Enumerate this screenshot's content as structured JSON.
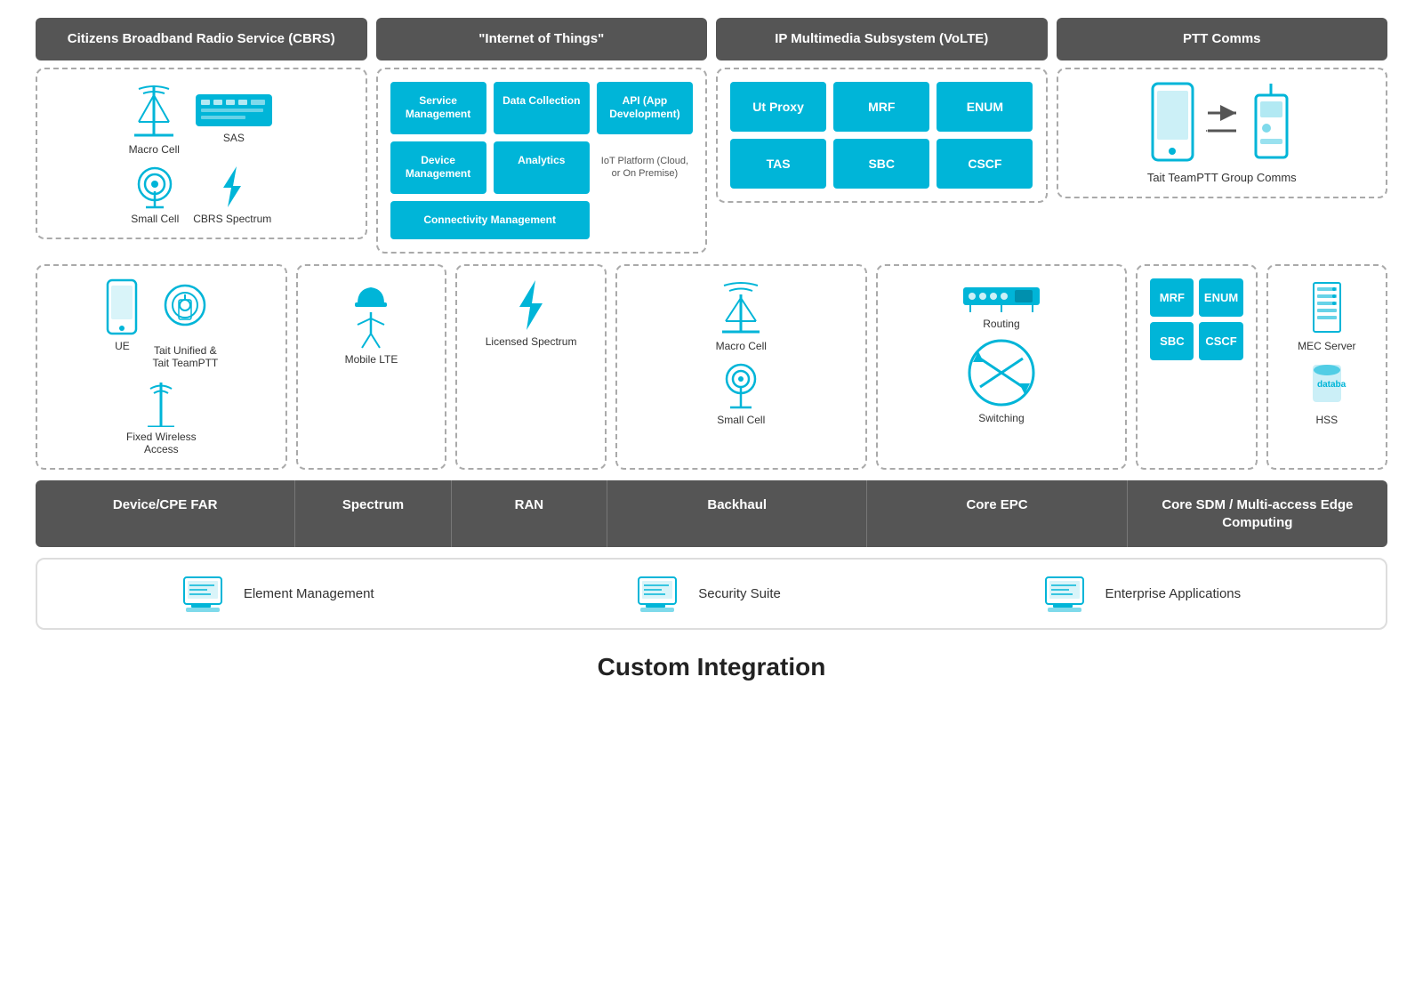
{
  "headers": {
    "cbrs": "Citizens Broadband Radio Service (CBRS)",
    "iot": "\"Internet of Things\"",
    "ims": "IP Multimedia Subsystem (VoLTE)",
    "ptt": "PTT Comms"
  },
  "cbrs": {
    "macro_cell": "Macro Cell",
    "sas": "SAS",
    "small_cell": "Small Cell",
    "cbrs_spectrum": "CBRS Spectrum"
  },
  "iot": {
    "boxes": [
      {
        "label": "Service Management",
        "span": 1
      },
      {
        "label": "Data Collection",
        "span": 1
      },
      {
        "label": "API (App Development)",
        "span": 1
      },
      {
        "label": "Device Management",
        "span": 1
      },
      {
        "label": "Analytics",
        "span": 1
      },
      {
        "label": "",
        "span": 1
      },
      {
        "label": "Connectivity Management",
        "span": 2
      }
    ],
    "platform_note": "IoT Platform (Cloud, or On Premise)"
  },
  "ims": {
    "boxes": [
      "Ut Proxy",
      "MRF",
      "ENUM",
      "TAS",
      "SBC",
      "CSCF"
    ]
  },
  "ptt": {
    "label": "Tait TeamPTT Group Comms"
  },
  "mid": {
    "col1_items": [
      "UE",
      "Tait Unified & Tait TeamPTT",
      "Fixed Wireless Access"
    ],
    "col2_items": [
      "Mobile LTE"
    ],
    "col3_items": [
      "Licensed Spectrum"
    ],
    "col4_items": [
      "Macro Cell",
      "Small Cell"
    ],
    "col5_routing": "Routing",
    "col5_switching": "Switching",
    "col6_ims_boxes": [
      "MRF",
      "ENUM",
      "SBC",
      "CSCF"
    ],
    "col7_items": [
      "MEC Server",
      "HSS"
    ]
  },
  "bottom_bar": {
    "items": [
      "Device/CPE FAR",
      "Spectrum",
      "RAN",
      "Backhaul",
      "Core EPC",
      "Core SDM / Multi-access Edge Computing"
    ]
  },
  "mgmt": {
    "items": [
      "Element Management",
      "Security Suite",
      "Enterprise Applications"
    ]
  },
  "footer": "Custom Integration"
}
